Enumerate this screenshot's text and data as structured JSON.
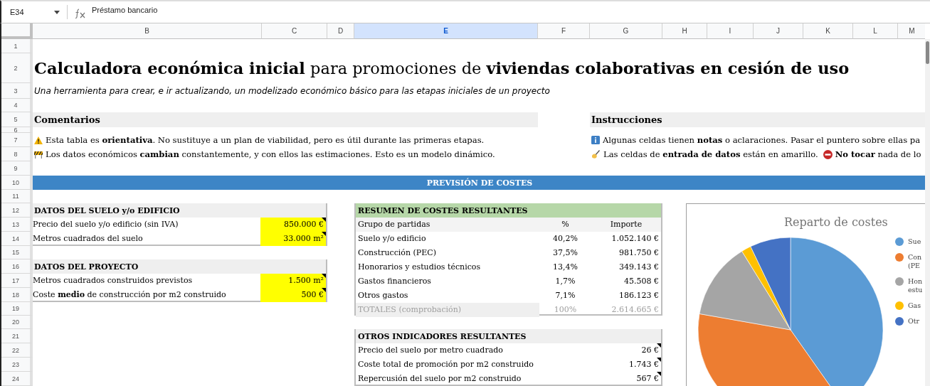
{
  "formula_bar": {
    "cell_ref": "E34",
    "content": "Préstamo bancario"
  },
  "columns": [
    {
      "label": "B",
      "selected": false
    },
    {
      "label": "C",
      "selected": false
    },
    {
      "label": "D",
      "selected": false
    },
    {
      "label": "E",
      "selected": true
    },
    {
      "label": "F",
      "selected": false
    },
    {
      "label": "G",
      "selected": false
    },
    {
      "label": "H",
      "selected": false
    },
    {
      "label": "I",
      "selected": false
    },
    {
      "label": "J",
      "selected": false
    },
    {
      "label": "K",
      "selected": false
    },
    {
      "label": "L",
      "selected": false
    },
    {
      "label": "M",
      "selected": false
    }
  ],
  "rows": [
    "1",
    "2",
    "3",
    "4",
    "5",
    "6",
    "7",
    "8",
    "9",
    "10",
    "11",
    "12",
    "13",
    "14",
    "15",
    "16",
    "17",
    "18",
    "19",
    "20",
    "21",
    "22",
    "23",
    "24"
  ],
  "title": "**Calculadora económica inicial** para promociones de **viviendas colaborativas en cesión de uso**",
  "subtitle": "Una herramienta para crear, e ir actualizando, un modelizado económico básico para las etapas iniciales de un proyecto",
  "comentarios": {
    "heading": "Comentarios",
    "lines": [
      [
        {
          "kind": "warning",
          "text": "Esta tabla es **orientativa**. No sustituye a un plan de viabilidad, pero es útil durante las primeras etapas."
        }
      ],
      [
        {
          "kind": "barrier",
          "text": "Los datos económicos **cambian** constantemente, y con ellos las estimaciones. Esto es un modelo dinámico."
        }
      ]
    ]
  },
  "instrucciones": {
    "heading": "Instrucciones",
    "lines": [
      [
        {
          "kind": "info",
          "text": "Algunas celdas tienen **notas** o aclaraciones. Pasar el puntero sobre ellas pa"
        }
      ],
      [
        {
          "kind": "writing",
          "text": "Las celdas de **entrada de datos** están en amarillo."
        },
        {
          "kind": "prohibited",
          "text": "**No tocar** nada de lo"
        }
      ]
    ]
  },
  "section_banner": "PREVISIÓN DE COSTES",
  "input_tables": [
    {
      "heading": "DATOS DEL SUELO y/o EDIFICIO",
      "rows": [
        {
          "label": "Precio del suelo y/o edificio (sin IVA)",
          "value": "850.000 €",
          "note": true
        },
        {
          "label": "Metros cuadrados del suelo",
          "value": "33.000 m²",
          "note": true
        }
      ]
    },
    {
      "heading": "DATOS DEL PROYECTO",
      "rows": [
        {
          "label": "Metros cuadrados construidos previstos",
          "value": "1.500 m²",
          "note": true
        },
        {
          "label": "Coste **medio** de construcción por m2 construido",
          "value": "500 €",
          "note": true
        }
      ]
    }
  ],
  "cost_summary": {
    "heading": "RESUMEN DE COSTES RESULTANTES",
    "columns": [
      "Grupo de partidas",
      "%",
      "Importe"
    ],
    "rows": [
      {
        "label": "Suelo y/o edificio",
        "percent": "40,2%",
        "amount": "1.052.140 €"
      },
      {
        "label": "Construcción (PEC)",
        "percent": "37,5%",
        "amount": "981.750 €"
      },
      {
        "label": "Honorarios y estudios técnicos",
        "percent": "13,4%",
        "amount": "349.143 €"
      },
      {
        "label": "Gastos financieros",
        "percent": "1,7%",
        "amount": "45.508 €"
      },
      {
        "label": "Otros gastos",
        "percent": "7,1%",
        "amount": "186.123 €"
      }
    ],
    "total": {
      "label": "TOTALES (comprobación)",
      "percent": "100%",
      "amount": "2.614.665 €"
    }
  },
  "other_indicators": {
    "heading": "OTROS INDICADORES RESULTANTES",
    "rows": [
      {
        "label": "Precio del suelo por metro cuadrado",
        "value": "26 €",
        "note": true
      },
      {
        "label": "Coste total de promoción por m2 construido",
        "value": "1.743 €",
        "note": true
      },
      {
        "label": "Repercusión del suelo por m2 construido",
        "value": "567 €",
        "note": true
      }
    ]
  },
  "chart": {
    "chart_data": {
      "type": "pie",
      "title": "Reparto de costes",
      "categories": [
        "Sue",
        "Con (PE",
        "Hon estu",
        "Gas",
        "Otr"
      ],
      "values": [
        40.2,
        37.5,
        13.4,
        1.7,
        7.1
      ],
      "legend": "right",
      "colors": [
        "#5b9bd5",
        "#ed7d31",
        "#a5a5a5",
        "#ffc000",
        "#4472c4"
      ]
    }
  }
}
